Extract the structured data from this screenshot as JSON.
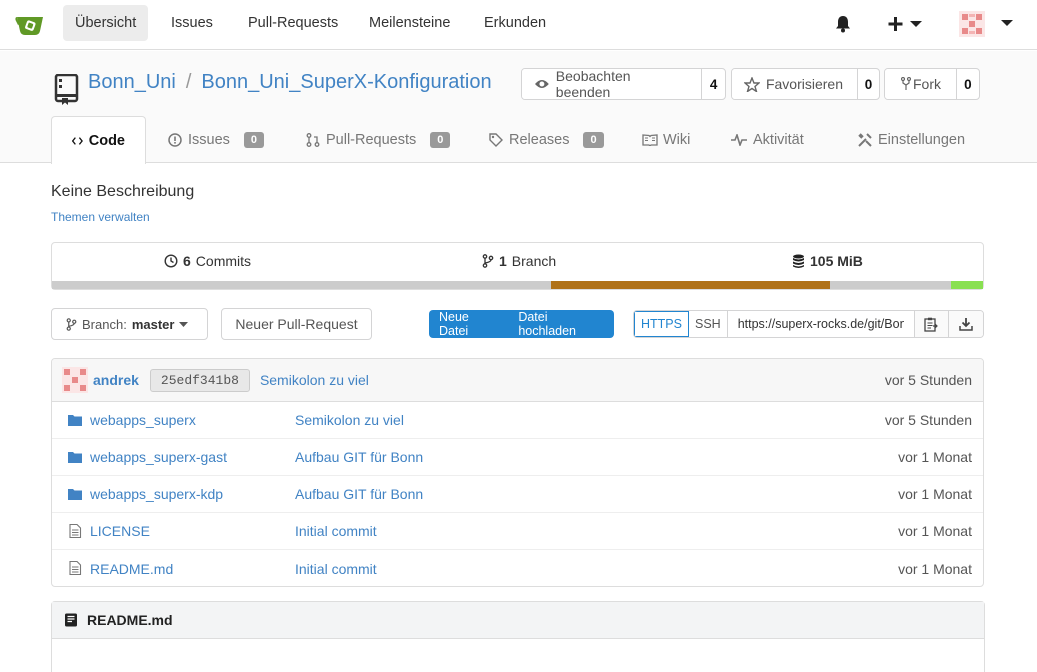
{
  "nav": {
    "items": [
      "Übersicht",
      "Issues",
      "Pull-Requests",
      "Meilensteine",
      "Erkunden"
    ]
  },
  "repo": {
    "owner": "Bonn_Uni",
    "separator": "/",
    "name": "Bonn_Uni_SuperX-Konfiguration",
    "watch": {
      "label": "Beobachten beenden",
      "count": "4"
    },
    "star": {
      "label": "Favorisieren",
      "count": "0"
    },
    "fork": {
      "label": "Fork",
      "count": "0"
    }
  },
  "tabs": [
    {
      "label": "Code"
    },
    {
      "label": "Issues",
      "badge": "0"
    },
    {
      "label": "Pull-Requests",
      "badge": "0"
    },
    {
      "label": "Releases",
      "badge": "0"
    },
    {
      "label": "Wiki"
    },
    {
      "label": "Aktivität"
    },
    {
      "label": "Einstellungen"
    }
  ],
  "description": "Keine Beschreibung",
  "topics_link": "Themen verwalten",
  "stats": {
    "commits_count": "6",
    "commits_label": "Commits",
    "branch_count": "1",
    "branch_label": "Branch",
    "size": "105 MiB"
  },
  "language_bar": [
    {
      "fraction": 0.536,
      "color": "#cccccc"
    },
    {
      "fraction": 0.3,
      "color": "#b07219"
    },
    {
      "fraction": 0.13,
      "color": "#cccccc"
    },
    {
      "fraction": 0.034,
      "color": "#89e051"
    }
  ],
  "branch": {
    "prefix": "Branch:",
    "name": "master"
  },
  "new_pr_label": "Neuer Pull-Request",
  "new_file_label": "Neue Datei",
  "upload_label": "Datei hochladen",
  "clone": {
    "https": "HTTPS",
    "ssh": "SSH",
    "url": "https://superx-rocks.de/git/Bonn_Uni/Bonn_Uni_SuperX-Konfiguration.git"
  },
  "last_commit": {
    "author": "andrek",
    "sha": "25edf341b8",
    "message": "Semikolon zu viel",
    "time": "vor 5 Stunden"
  },
  "files": [
    {
      "type": "dir",
      "name": "webapps_superx",
      "message": "Semikolon zu viel",
      "time": "vor 5 Stunden"
    },
    {
      "type": "dir",
      "name": "webapps_superx-gast",
      "message": "Aufbau GIT für Bonn",
      "time": "vor 1 Monat"
    },
    {
      "type": "dir",
      "name": "webapps_superx-kdp",
      "message": "Aufbau GIT für Bonn",
      "time": "vor 1 Monat"
    },
    {
      "type": "file",
      "name": "LICENSE",
      "message": "Initial commit",
      "time": "vor 1 Monat"
    },
    {
      "type": "file",
      "name": "README.md",
      "message": "Initial commit",
      "time": "vor 1 Monat"
    }
  ],
  "readme_title": "README.md",
  "colors": {
    "link": "#4183c4",
    "primary": "#2185d0",
    "logo": "#609926"
  }
}
